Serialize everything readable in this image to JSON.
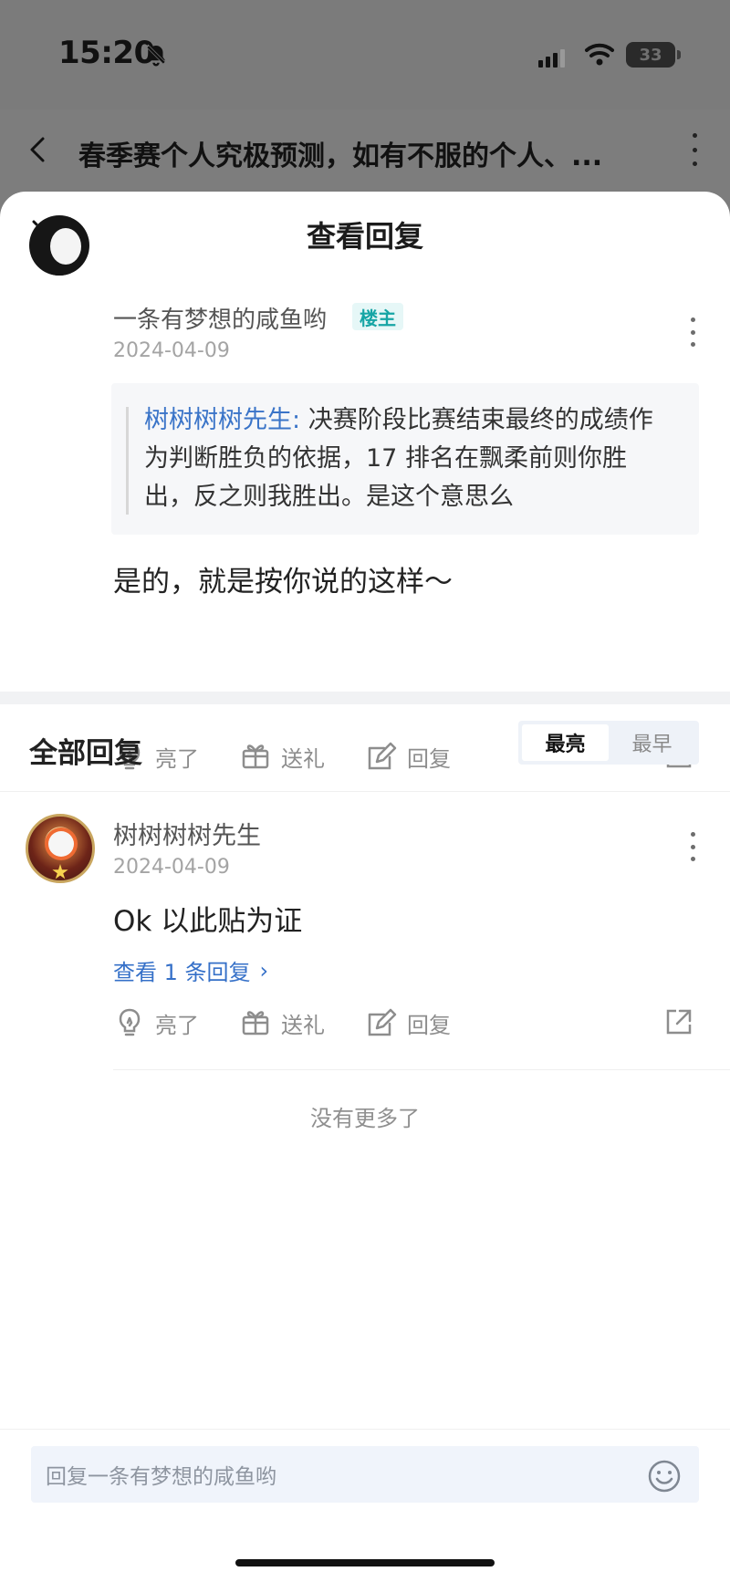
{
  "status": {
    "time": "15:20",
    "battery": "33"
  },
  "topbar": {
    "title": "春季赛个人究极预测，如有不服的个人、..."
  },
  "sheet": {
    "title": "查看回复"
  },
  "main_comment": {
    "author": "一条有梦想的咸鱼哟",
    "badge": "楼主",
    "date": "2024-04-09",
    "quote_author": "树树树树先生:",
    "quote_text": " 决赛阶段比赛结束最终的成绩作为判断胜负的依据，17 排名在飘柔前则你胜出，反之则我胜出。是这个意思么",
    "reply": "是的，就是按你说的这样～",
    "actions": {
      "like": "亮了",
      "gift": "送礼",
      "reply": "回复"
    }
  },
  "section": {
    "title": "全部回复",
    "sort": {
      "active": "最亮",
      "inactive": "最早"
    }
  },
  "reply_item": {
    "author": "树树树树先生",
    "date": "2024-04-09",
    "body": "Ok 以此贴为证",
    "view_more": "查看 1 条回复",
    "actions": {
      "like": "亮了",
      "gift": "送礼",
      "reply": "回复"
    }
  },
  "footer": {
    "no_more": "没有更多了",
    "input_placeholder": "回复一条有梦想的咸鱼哟"
  },
  "icons": {
    "back": "back-icon",
    "close": "close-icon",
    "more": "more-icon",
    "like": "lightbulb-icon",
    "gift": "gift-icon",
    "reply": "edit-icon",
    "share": "share-icon",
    "emoji": "smile-icon"
  },
  "colors": {
    "accent_blue": "#3570c8",
    "host_badge": "#16a5a5",
    "muted": "#8d8d8d"
  }
}
